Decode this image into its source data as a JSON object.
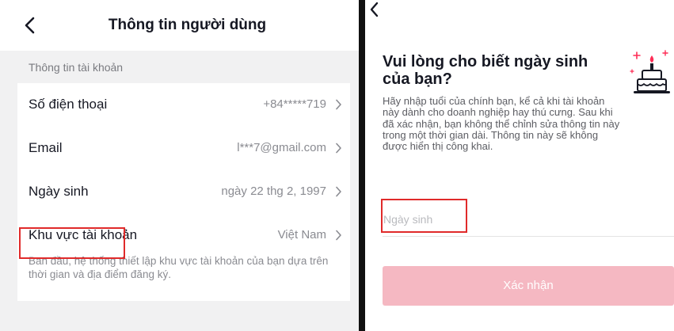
{
  "left_screen": {
    "title": "Thông tin người dùng",
    "section_title": "Thông tin tài khoản",
    "rows": [
      {
        "label": "Số điện thoại",
        "value": "+84*****719"
      },
      {
        "label": "Email",
        "value": "l***7@gmail.com"
      },
      {
        "label": "Ngày sinh",
        "value": "ngày 22 thg 2, 1997"
      },
      {
        "label": "Khu vực tài khoản",
        "value": "Việt Nam"
      }
    ],
    "region_note": "Ban đầu, hệ thống thiết lập khu vực tài khoản của bạn dựa trên thời gian và địa điểm đăng ký."
  },
  "right_screen": {
    "heading": "Vui lòng cho biết ngày sinh của bạn?",
    "description": "Hãy nhập tuổi của chính bạn, kể cả khi tài khoản này dành cho doanh nghiệp hay thú cưng. Sau khi đã xác nhận, bạn không thể chỉnh sửa thông tin này trong một thời gian dài. Thông tin này sẽ không được hiển thị công khai.",
    "dob_placeholder": "Ngày sinh",
    "confirm_label": "Xác nhận"
  },
  "icons": {
    "back": "chevron-left-icon",
    "row_arrow": "chevron-right-icon",
    "illustration": "birthday-cake-icon"
  },
  "colors": {
    "highlight_border": "#e02a2a",
    "confirm_button": "#f5b8c2",
    "cake_accent": "#fe2c55",
    "background_grey": "#f1f1f2"
  }
}
